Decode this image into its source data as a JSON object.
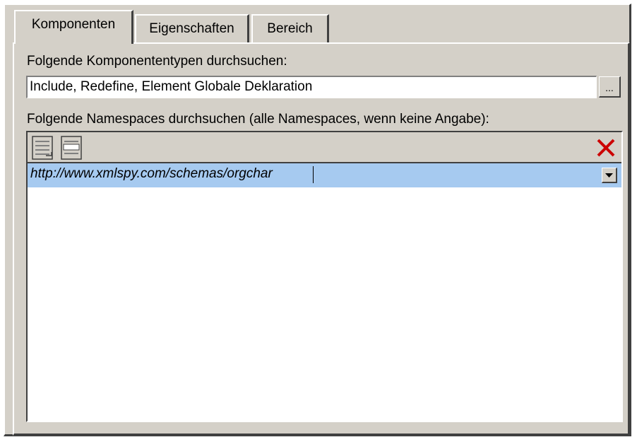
{
  "tabs": [
    {
      "label": "Komponenten",
      "active": true
    },
    {
      "label": "Eigenschaften",
      "active": false
    },
    {
      "label": "Bereich",
      "active": false
    }
  ],
  "component_types": {
    "label": "Folgende Komponententypen durchsuchen:",
    "value": "Include, Redefine, Element Globale Deklaration",
    "browse_label": "..."
  },
  "namespaces": {
    "label": "Folgende Namespaces durchsuchen (alle Namespaces, wenn keine Angabe):",
    "toolbar_icons": [
      "append-row-icon",
      "insert-row-icon",
      "delete-row-icon"
    ],
    "rows": [
      {
        "value": "http://www.xmlspy.com/schemas/orgchar",
        "selected": true
      }
    ]
  },
  "colors": {
    "face": "#d4d0c8",
    "selection": "#a6caf0",
    "delete_icon": "#cc0000"
  }
}
